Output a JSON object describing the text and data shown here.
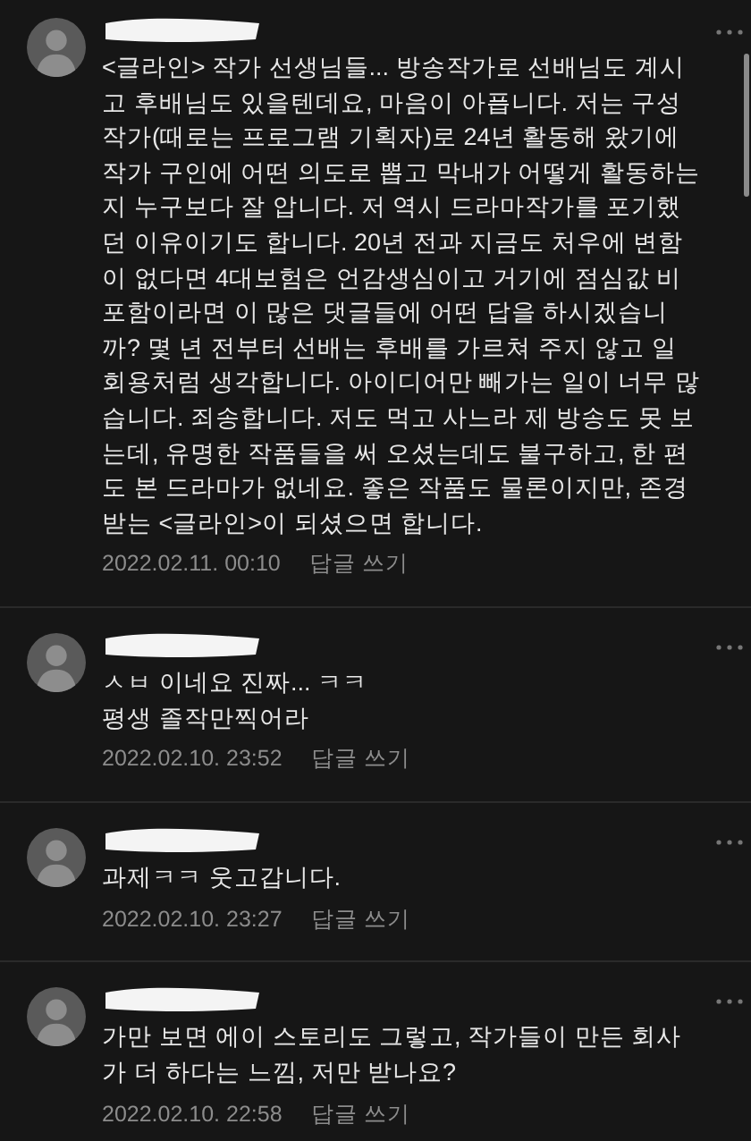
{
  "comments": [
    {
      "text": "<글라인> 작가 선생님들... 방송작가로 선배님도 계시고 후배님도 있을텐데요, 마음이 아픕니다. 저는 구성작가(때로는 프로그램 기획자)로 24년 활동해 왔기에 작가 구인에 어떤 의도로 뽑고 막내가 어떻게 활동하는 지 누구보다 잘 압니다. 저 역시 드라마작가를 포기했던 이유이기도 합니다. 20년 전과 지금도 처우에 변함이 없다면 4대보험은 언감생심이고 거기에 점심값 비포함이라면 이 많은 댓글들에 어떤 답을 하시겠습니까? 몇 년 전부터 선배는 후배를 가르쳐 주지 않고 일회용처럼 생각합니다. 아이디어만 빼가는 일이 너무 많습니다. 죄송합니다. 저도 먹고 사느라 제 방송도 못 보는데, 유명한 작품들을 써 오셨는데도 불구하고, 한 편도 본 드라마가 없네요. 좋은 작품도 물론이지만, 존경받는 <글라인>이 되셨으면 합니다.",
      "date": "2022.02.11. 00:10",
      "reply": "답글 쓰기"
    },
    {
      "text": "ㅅㅂ 이네요 진짜... ㅋㅋ\n평생 졸작만찍어라",
      "date": "2022.02.10. 23:52",
      "reply": "답글 쓰기"
    },
    {
      "text": "과제ㅋㅋ 웃고갑니다.",
      "date": "2022.02.10. 23:27",
      "reply": "답글 쓰기"
    },
    {
      "text": "가만 보면 에이 스토리도 그렇고, 작가들이 만든 회사가 더 하다는 느낌, 저만 받나요?",
      "date": "2022.02.10. 22:58",
      "reply": "답글 쓰기"
    }
  ]
}
